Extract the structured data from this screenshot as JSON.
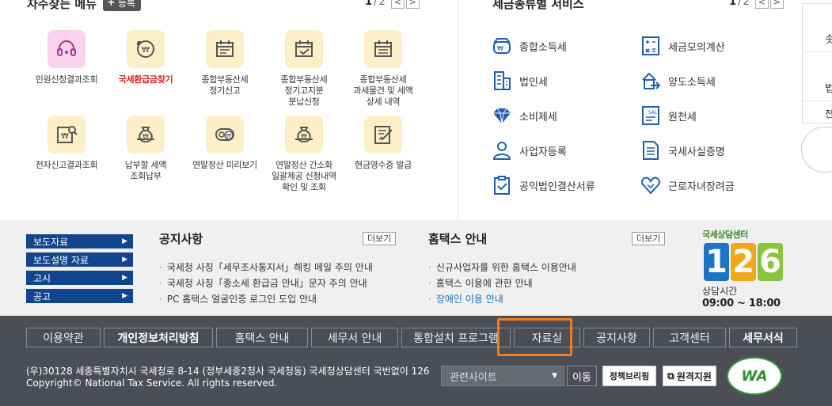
{
  "favorites": {
    "title": "자주찾는 메뉴",
    "add_label": "등록",
    "pager": {
      "current": "1",
      "total": "2",
      "prev": "<",
      "next": ">"
    },
    "rows": [
      [
        {
          "label": "민원신청결과조회",
          "icon": "headset-icon"
        },
        {
          "label": "국세환급금찾기",
          "icon": "refund-coin-icon"
        },
        {
          "label": "종합부동산세\n정기신고",
          "icon": "calendar-icon"
        },
        {
          "label": "종합부동산세\n정기고지분\n분납신청",
          "icon": "calendar-check-icon"
        },
        {
          "label": "종합부동산세\n과세물건 및 세액\n상세 내역",
          "icon": "calendar-detail-icon"
        }
      ],
      [
        {
          "label": "전자신고결과조회",
          "icon": "search-document-icon"
        },
        {
          "label": "납부할 세액\n조회납부",
          "icon": "money-bag-icon"
        },
        {
          "label": "연말정산 미리보기",
          "icon": "coin-preview-icon"
        },
        {
          "label": "연말정산 간소화\n일괄제공 신청내역\n확인 및 조회",
          "icon": "money-bag-list-icon"
        },
        {
          "label": "현금영수증 발급",
          "icon": "receipt-icon"
        }
      ]
    ]
  },
  "services": {
    "title": "세금종류별 서비스",
    "pager": {
      "current": "1",
      "total": "2",
      "prev": "<",
      "next": ">"
    },
    "rows": [
      [
        {
          "label": "종합소득세",
          "icon": "income-tax-icon"
        },
        {
          "label": "세금모의계산",
          "icon": "calculator-icon"
        }
      ],
      [
        {
          "label": "법인세",
          "icon": "building-icon"
        },
        {
          "label": "양도소득세",
          "icon": "transfer-icon"
        }
      ],
      [
        {
          "label": "소비제세",
          "icon": "diamond-icon"
        },
        {
          "label": "원천세",
          "icon": "withholding-icon"
        }
      ],
      [
        {
          "label": "사업자등록",
          "icon": "person-icon"
        },
        {
          "label": "국세사실증명",
          "icon": "certificate-icon"
        }
      ],
      [
        {
          "label": "공익법인결산서류",
          "icon": "clipboard-icon"
        },
        {
          "label": "근로자녀장려금",
          "icon": "heart-icon"
        }
      ]
    ]
  },
  "side_panel": {
    "text1": "솟",
    "text2": "법",
    "text3": "전"
  },
  "categories": [
    "보도자료",
    "보도설명 자료",
    "고시",
    "공고"
  ],
  "notice": {
    "title": "공지사항",
    "more": "더보기",
    "items": [
      "국세청 사칭「세무조사통지서」해킹 메일 주의 안내",
      "국세청 사칭「종소세 환급금 안내」문자 주의 안내",
      "PC 홈택스 얼굴인증 로그인 도입 안내"
    ]
  },
  "hometax": {
    "title": "홈택스 안내",
    "more": "더보기",
    "items": [
      "신규사업자를 위한 홈택스 이용안내",
      "홈택스 이용에 관한 안내",
      "장애인 이용 안내"
    ]
  },
  "center": {
    "name": "국세상담센터",
    "number_digits": [
      "1",
      "2",
      "6"
    ],
    "hours_label": "상담시간",
    "hours": "09:00 ~ 18:00",
    "colors": [
      "#1e74c4",
      "#f2a81d",
      "#8ac43f"
    ]
  },
  "footer": {
    "nav": [
      {
        "label": "이용약관",
        "bold": false
      },
      {
        "label": "개인정보처리방침",
        "bold": true
      },
      {
        "label": "홈택스 안내",
        "bold": false
      },
      {
        "label": "세무서 안내",
        "bold": false
      },
      {
        "label": "통합설치 프로그램",
        "bold": false
      },
      {
        "label": "자료실",
        "bold": false
      },
      {
        "label": "공지사항",
        "bold": false
      },
      {
        "label": "고객센터",
        "bold": false
      },
      {
        "label": "세무서식",
        "bold": true
      }
    ],
    "address": "(우)30128 세종특별자치시 국세청로 8-14 (정부세종2청사 국세청동) 국세청상담센터 국번없이 126",
    "copyright": "Copyright© National Tax Service. All rights reserved.",
    "related_site": "관련사이트",
    "go": "이동",
    "policy_badge": "정책브리핑",
    "remote_support": "원격지원",
    "wa_mark": "WA",
    "highlight_color": "#f07c1c"
  }
}
